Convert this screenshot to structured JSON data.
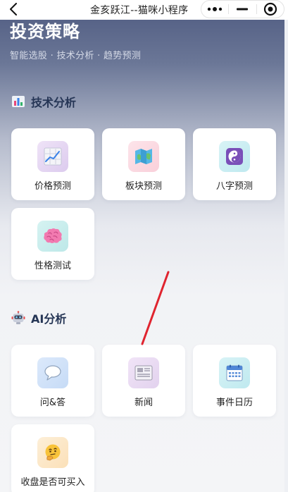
{
  "navbar": {
    "title": "金亥跃江--猫咪小程序",
    "back_icon": "chevron-left-icon",
    "more_icon": "more-dots-icon",
    "minimize_icon": "minimize-icon",
    "close_icon": "target-close-icon"
  },
  "hero": {
    "title": "投资策略",
    "subtitle": "智能选股 · 技术分析 · 趋势预测"
  },
  "sections": {
    "tech": {
      "label": "技术分析",
      "icon": "bar-chart-icon",
      "cards": [
        {
          "label": "价格预测",
          "icon": "chart-grid-icon"
        },
        {
          "label": "板块预测",
          "icon": "map-icon"
        },
        {
          "label": "八字预测",
          "icon": "yin-yang-icon"
        },
        {
          "label": "性格测试",
          "icon": "brain-icon"
        }
      ]
    },
    "ai": {
      "label": "AI分析",
      "icon": "robot-icon",
      "cards": [
        {
          "label": "问&答",
          "icon": "speech-bubble-icon"
        },
        {
          "label": "新闻",
          "icon": "newspaper-icon"
        },
        {
          "label": "事件日历",
          "icon": "calendar-icon"
        },
        {
          "label": "收盘是否可买入",
          "icon": "thinking-face-icon"
        }
      ]
    }
  },
  "colors": {
    "annotation": "#e0242f",
    "section_title": "#253555"
  }
}
